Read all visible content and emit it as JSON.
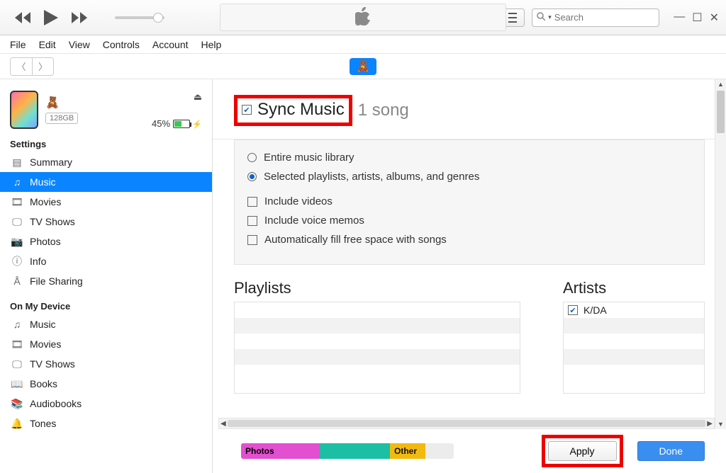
{
  "menubar": [
    "File",
    "Edit",
    "View",
    "Controls",
    "Account",
    "Help"
  ],
  "search": {
    "placeholder": "Search"
  },
  "device": {
    "storage": "128GB",
    "battery_pct": "45%"
  },
  "sidebar": {
    "section_settings": "Settings",
    "settings": [
      "Summary",
      "Music",
      "Movies",
      "TV Shows",
      "Photos",
      "Info",
      "File Sharing"
    ],
    "section_device": "On My Device",
    "device": [
      "Music",
      "Movies",
      "TV Shows",
      "Books",
      "Audiobooks",
      "Tones"
    ]
  },
  "sync": {
    "title": "Sync Music",
    "count": "1 song",
    "opt_entire": "Entire music library",
    "opt_selected": "Selected playlists, artists, albums, and genres",
    "ck_videos": "Include videos",
    "ck_memos": "Include voice memos",
    "ck_autofill": "Automatically fill free space with songs"
  },
  "lists": {
    "playlists_title": "Playlists",
    "artists_title": "Artists",
    "artists": [
      "K/DA"
    ]
  },
  "usage": {
    "photos": "Photos",
    "other": "Other"
  },
  "buttons": {
    "apply": "Apply",
    "done": "Done"
  }
}
